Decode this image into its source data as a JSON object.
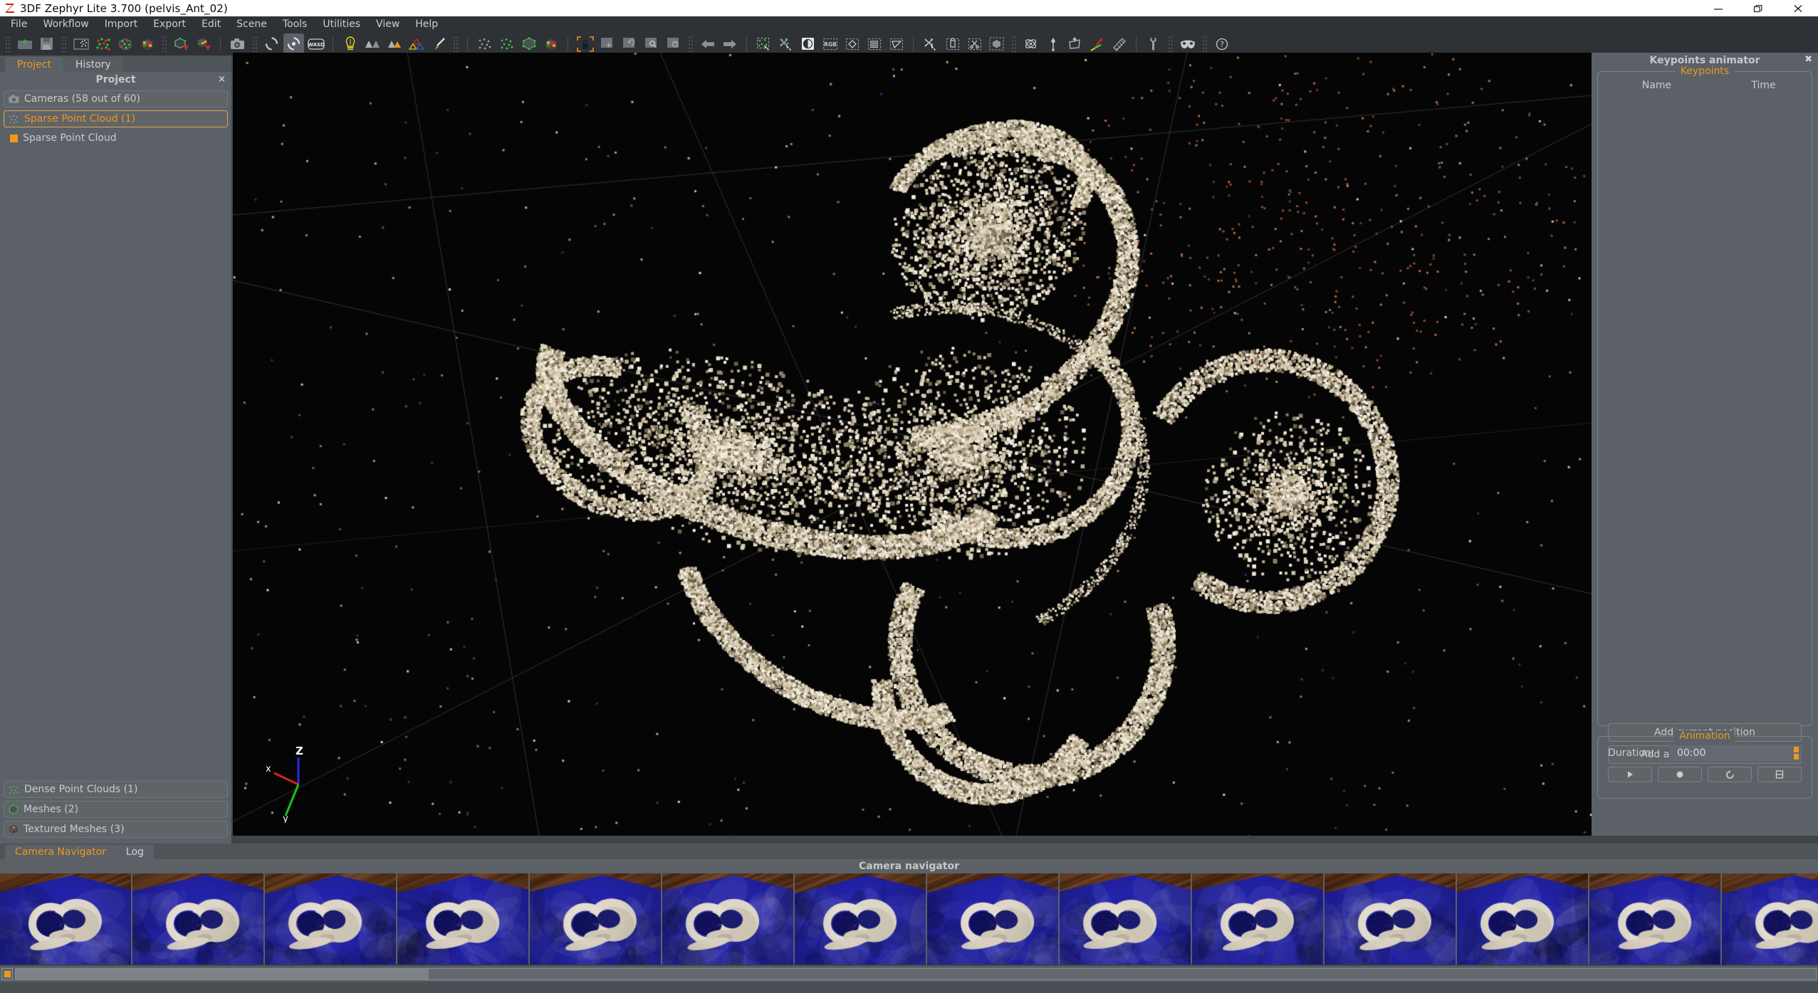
{
  "window": {
    "app_icon": "zephyr-z-icon",
    "title": "3DF Zephyr Lite 3.700 (pelvis_Ant_02)",
    "minimize_label": "minimize-icon",
    "maximize_label": "restore-icon",
    "close_label": "close-icon"
  },
  "menubar": {
    "items": [
      {
        "label": "File"
      },
      {
        "label": "Workflow"
      },
      {
        "label": "Import"
      },
      {
        "label": "Export"
      },
      {
        "label": "Edit"
      },
      {
        "label": "Scene"
      },
      {
        "label": "Tools"
      },
      {
        "label": "Utilities"
      },
      {
        "label": "View"
      },
      {
        "label": "Help"
      }
    ]
  },
  "toolbar": {
    "groups": [
      {
        "type": "grip"
      },
      {
        "type": "button",
        "name": "open-project-icon",
        "glyph": "folder-open"
      },
      {
        "type": "button",
        "name": "save-project-icon",
        "glyph": "floppy"
      },
      {
        "type": "grip"
      },
      {
        "type": "button",
        "name": "new-project-wizard-icon",
        "glyph": "photos-frame"
      },
      {
        "type": "button",
        "name": "sparse-cloud-generation-icon",
        "glyph": "sparse-dots"
      },
      {
        "type": "button",
        "name": "dense-cloud-generation-icon",
        "glyph": "dense-cube"
      },
      {
        "type": "button",
        "name": "mesh-generation-icon",
        "glyph": "textured-cube"
      },
      {
        "type": "grip"
      },
      {
        "type": "button",
        "name": "mesh-extraction-icon",
        "glyph": "cube-arrow"
      },
      {
        "type": "button",
        "name": "texture-extraction-icon",
        "glyph": "textured-cube-arrow"
      },
      {
        "type": "sep"
      },
      {
        "type": "button",
        "name": "camera-snapshot-icon",
        "glyph": "camera"
      },
      {
        "type": "grip"
      },
      {
        "type": "button",
        "name": "turntable-rotate-icon",
        "glyph": "rot-open"
      },
      {
        "type": "button",
        "name": "navigation-mode-icon",
        "glyph": "rot-dot",
        "active": true
      },
      {
        "type": "button",
        "name": "wasd-navigation-icon",
        "glyph": "wasd"
      },
      {
        "type": "sep"
      },
      {
        "type": "button",
        "name": "lighting-icon",
        "glyph": "bulb"
      },
      {
        "type": "button",
        "name": "shading-flat-icon",
        "glyph": "tri-gray"
      },
      {
        "type": "button",
        "name": "shading-smooth-icon",
        "glyph": "tri-orange"
      },
      {
        "type": "button",
        "name": "shading-wire-icon",
        "glyph": "tri-outline"
      },
      {
        "type": "button",
        "name": "paint-brush-icon",
        "glyph": "brush"
      },
      {
        "type": "grip"
      },
      {
        "type": "sep"
      },
      {
        "type": "button",
        "name": "show-sparse-points-icon",
        "glyph": "dots-gray"
      },
      {
        "type": "button",
        "name": "show-dense-points-icon",
        "glyph": "dots-green"
      },
      {
        "type": "button",
        "name": "show-mesh-icon",
        "glyph": "cube-green"
      },
      {
        "type": "button",
        "name": "show-textured-mesh-icon",
        "glyph": "textured-cube"
      },
      {
        "type": "sep"
      },
      {
        "type": "button",
        "name": "lock-selection-icon",
        "glyph": "lock"
      },
      {
        "type": "button",
        "name": "pan-tool-icon",
        "glyph": "sq-move"
      },
      {
        "type": "button",
        "name": "rotate-tool-icon",
        "glyph": "sq-rotate"
      },
      {
        "type": "button",
        "name": "zoom-tool-icon",
        "glyph": "sq-zoom"
      },
      {
        "type": "button",
        "name": "reset-view-icon",
        "glyph": "sq-power"
      },
      {
        "type": "grip"
      },
      {
        "type": "button",
        "name": "undo-icon",
        "glyph": "arrow-left"
      },
      {
        "type": "button",
        "name": "redo-icon",
        "glyph": "arrow-right"
      },
      {
        "type": "sep"
      },
      {
        "type": "button",
        "name": "select-points-icon",
        "glyph": "select-dots"
      },
      {
        "type": "button",
        "name": "deselect-points-icon",
        "glyph": "deselect-dots"
      },
      {
        "type": "button",
        "name": "invert-selection-icon",
        "glyph": "contrast"
      },
      {
        "type": "button",
        "name": "rgb-filter-icon",
        "glyph": "rgb"
      },
      {
        "type": "button",
        "name": "polygon-select-icon",
        "glyph": "diamond"
      },
      {
        "type": "button",
        "name": "grid-select-icon",
        "glyph": "grid"
      },
      {
        "type": "button",
        "name": "lasso-select-icon",
        "glyph": "triangle-dash"
      },
      {
        "type": "sep"
      },
      {
        "type": "button",
        "name": "crop-selection-icon",
        "glyph": "scissor-dots"
      },
      {
        "type": "button",
        "name": "copy-selection-icon",
        "glyph": "copy-dash"
      },
      {
        "type": "button",
        "name": "cut-selection-icon",
        "glyph": "scissors-dash"
      },
      {
        "type": "button",
        "name": "bounding-box-icon",
        "glyph": "cube-dash"
      },
      {
        "type": "grip"
      },
      {
        "type": "button",
        "name": "orbit-icon",
        "glyph": "atom"
      },
      {
        "type": "button",
        "name": "pin-icon",
        "glyph": "pin"
      },
      {
        "type": "button",
        "name": "camera-frustum-icon",
        "glyph": "frustum"
      },
      {
        "type": "button",
        "name": "reference-system-icon",
        "glyph": "axes"
      },
      {
        "type": "button",
        "name": "measure-icon",
        "glyph": "ruler"
      },
      {
        "type": "sep"
      },
      {
        "type": "button",
        "name": "settings-wrench-icon",
        "glyph": "wrench"
      },
      {
        "type": "grip"
      },
      {
        "type": "button",
        "name": "mask-icon",
        "glyph": "mask"
      },
      {
        "type": "grip"
      },
      {
        "type": "button",
        "name": "help-icon",
        "glyph": "question"
      }
    ]
  },
  "left_panel": {
    "tabs": [
      {
        "label": "Project",
        "selected": true
      },
      {
        "label": "History",
        "selected": false
      }
    ],
    "header": "Project",
    "close_label": "×",
    "top_nodes": [
      {
        "label": "Cameras (58 out of 60)",
        "icon": "camera-icon",
        "selected": false
      },
      {
        "label": "Sparse Point Cloud (1)",
        "icon": "sparse-points-icon",
        "selected": true
      }
    ],
    "children": [
      {
        "label": "Sparse Point Cloud",
        "swatch": "#f2991d"
      }
    ],
    "bottom_nodes": [
      {
        "label": "Dense Point Clouds (1)",
        "icon": "dense-points-icon",
        "selected": false
      },
      {
        "label": "Meshes (2)",
        "icon": "mesh-icon",
        "selected": false
      },
      {
        "label": "Textured Meshes (3)",
        "icon": "textured-mesh-icon",
        "selected": false
      }
    ]
  },
  "viewport": {
    "background": "#050505",
    "axis": {
      "x_label": "x",
      "x_color": "#d92020",
      "y_label": "y",
      "y_color": "#17c317",
      "z_label": "Z",
      "z_color": "#2222dd"
    }
  },
  "right_panel": {
    "title": "Keypoints animator",
    "close_label": "✖",
    "keypoints_group": {
      "title": "Keypoints",
      "columns": [
        "Name",
        "Time"
      ],
      "rows": []
    },
    "buttons": [
      {
        "label": "Add current position"
      },
      {
        "label": "Add all cameras positions"
      }
    ],
    "animation_group": {
      "title": "Animation",
      "duration_label": "Duration:",
      "duration_value": "00:00",
      "controls": [
        {
          "name": "play-button",
          "glyph": "play"
        },
        {
          "name": "record-button",
          "glyph": "record"
        },
        {
          "name": "loop-button",
          "glyph": "loop"
        },
        {
          "name": "export-video-button",
          "glyph": "film"
        }
      ]
    }
  },
  "bottom": {
    "tabs": [
      {
        "label": "Camera Navigator",
        "selected": true
      },
      {
        "label": "Log",
        "selected": false
      }
    ],
    "navigator_title": "Camera navigator",
    "thumbnails": [
      {
        "name": "camera-thumbnail"
      },
      {
        "name": "camera-thumbnail"
      },
      {
        "name": "camera-thumbnail"
      },
      {
        "name": "camera-thumbnail"
      },
      {
        "name": "camera-thumbnail"
      },
      {
        "name": "camera-thumbnail"
      },
      {
        "name": "camera-thumbnail"
      },
      {
        "name": "camera-thumbnail"
      },
      {
        "name": "camera-thumbnail"
      },
      {
        "name": "camera-thumbnail"
      },
      {
        "name": "camera-thumbnail"
      },
      {
        "name": "camera-thumbnail"
      },
      {
        "name": "camera-thumbnail"
      },
      {
        "name": "camera-thumbnail"
      }
    ]
  },
  "colors": {
    "panel_bg": "#5b6166",
    "toolbar_bg": "#2e3236",
    "accent": "#eb9720",
    "text": "#c6cbcf",
    "viewport_bg": "#050505"
  }
}
